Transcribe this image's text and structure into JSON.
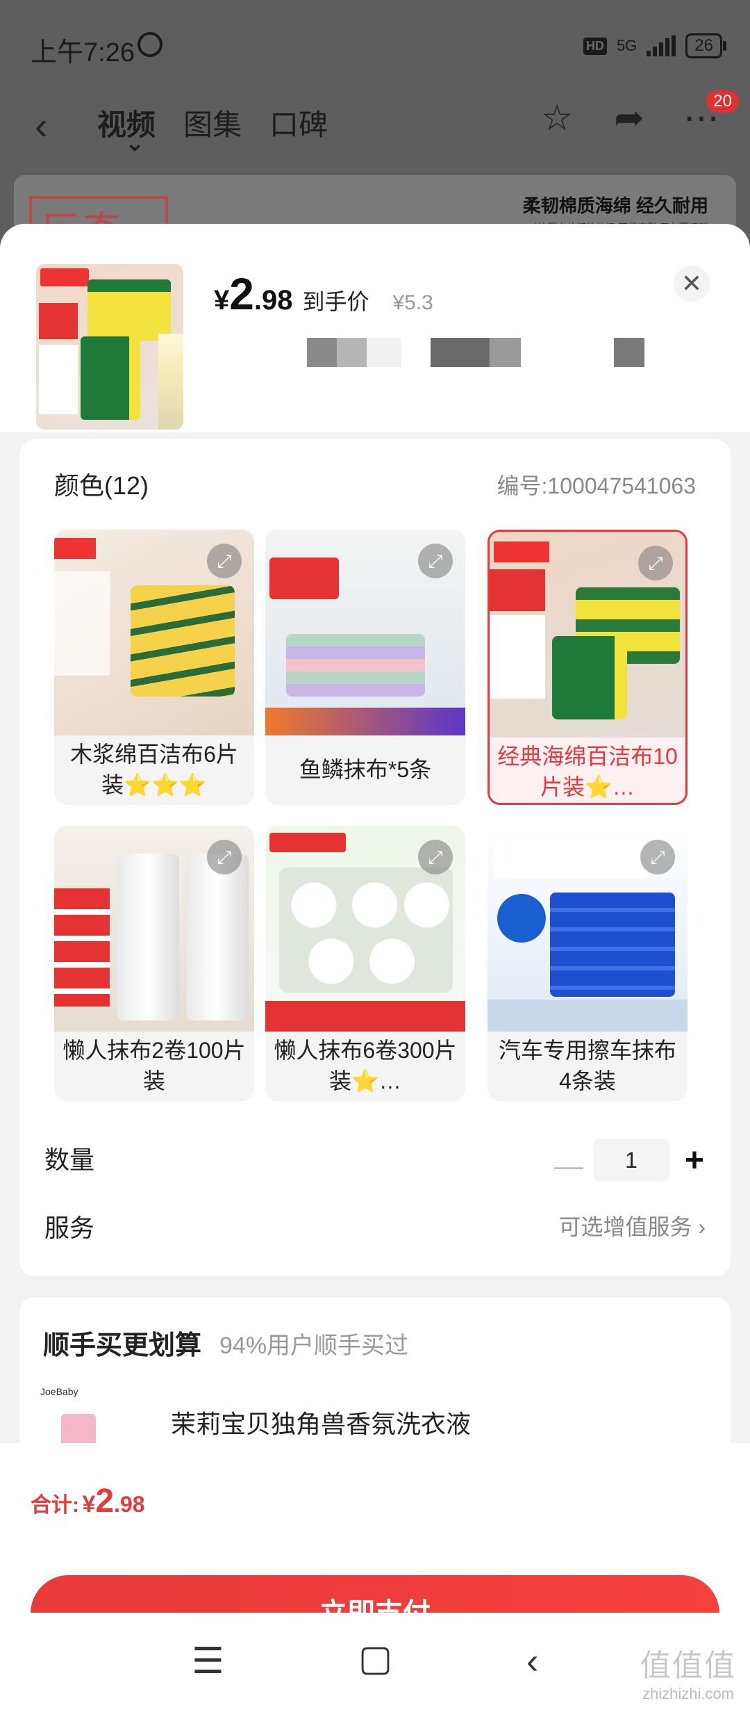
{
  "status_bar": {
    "time": "上午7:26",
    "hd": "HD",
    "network": "5G",
    "battery": "26"
  },
  "nav": {
    "tabs": [
      "视频",
      "图集",
      "口碑"
    ],
    "badge_count": "20"
  },
  "bg_banner": {
    "logo_text": "巨奇",
    "headline": "柔韧棉质海绵 经久耐用",
    "subline": "对抗压力的韧性依旧 不易变形 用久而旧新"
  },
  "product": {
    "price_symbol": "¥",
    "price_int": "2",
    "price_dec": ".98",
    "price_tag": "到手价",
    "original_price": "¥5.3"
  },
  "options": {
    "title": "颜色(12)",
    "code": "编号:100047541063",
    "variants": [
      {
        "label": "木浆绵百洁布6片装⭐⭐⭐",
        "selected": false
      },
      {
        "label": "鱼鳞抹布*5条",
        "selected": false
      },
      {
        "label": "经典海绵百洁布10片装⭐…",
        "selected": true
      },
      {
        "label": "懒人抹布2卷100片装",
        "selected": false
      },
      {
        "label": "懒人抹布6卷300片装⭐…",
        "selected": false
      },
      {
        "label": "汽车专用擦车抹布4条装",
        "selected": false
      }
    ],
    "quantity_label": "数量",
    "quantity": "1",
    "service_label": "服务",
    "service_value": "可选增值服务"
  },
  "upsell": {
    "title": "顺手买更划算",
    "subtitle": "94%用户顺手买过",
    "brand": "JoeBaby",
    "item_name": "茉莉宝贝独角兽香氛洗衣液"
  },
  "footer": {
    "total_label": "合计:",
    "total_symbol": "¥",
    "total_int": "2",
    "total_dec": ".98",
    "pay_label": "立即支付"
  },
  "watermark": {
    "big": "值值值",
    "small": "zhizhizhi.com"
  },
  "colors": {
    "accent": "#e8373d",
    "pay_button": "#f0403c"
  }
}
